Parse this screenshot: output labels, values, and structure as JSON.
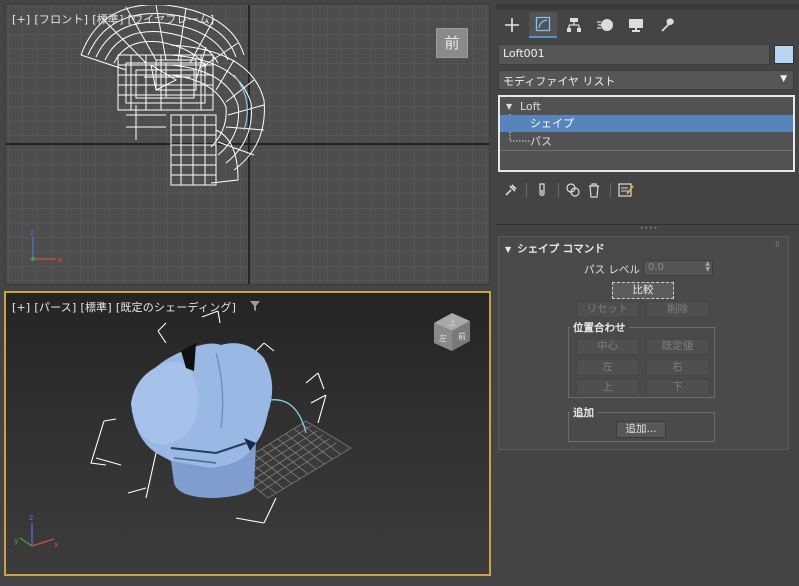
{
  "front_viewport": {
    "labels": [
      "[+]",
      "[フロント]",
      "[標準]",
      "[ワイヤフレーム]"
    ],
    "viewcube_label": "前"
  },
  "persp_viewport": {
    "labels": [
      "[+]",
      "[パース]",
      "[標準]",
      "[既定のシェーディング]"
    ],
    "viewcube_top": "上",
    "viewcube_front": "前",
    "viewcube_left": "左"
  },
  "axis": {
    "x": "x",
    "y": "y",
    "z": "z"
  },
  "command_panel": {
    "tabs": [
      {
        "name": "create",
        "icon": "plus-icon"
      },
      {
        "name": "modify",
        "icon": "modify-icon"
      },
      {
        "name": "hierarchy",
        "icon": "hierarchy-icon"
      },
      {
        "name": "motion",
        "icon": "motion-icon"
      },
      {
        "name": "display",
        "icon": "display-icon"
      },
      {
        "name": "utilities",
        "icon": "wrench-icon"
      }
    ],
    "object_name": "Loft001",
    "object_color": "#b9d3f2",
    "modifier_list": "モディファイヤ リスト",
    "stack": {
      "root": "Loft",
      "items": [
        "シェイプ",
        "パス"
      ],
      "selected": "シェイプ"
    }
  },
  "shape_commands": {
    "title": "シェイプ コマンド",
    "path_level_label": "パス レベル :",
    "path_level_value": "0.0",
    "compare_button": "比較",
    "reset_button": "リセット",
    "delete_button": "削除",
    "align_group": {
      "title": "位置合わせ",
      "center": "中心",
      "default": "既定値",
      "left": "左",
      "right": "右",
      "top": "上",
      "bottom": "下"
    },
    "put_group": {
      "title": "追加",
      "put_button": "追加..."
    }
  },
  "colors": {
    "accent": "#5884be",
    "active_viewport_border": "#c8a34a",
    "shape_blue": "#9ab8e4"
  }
}
